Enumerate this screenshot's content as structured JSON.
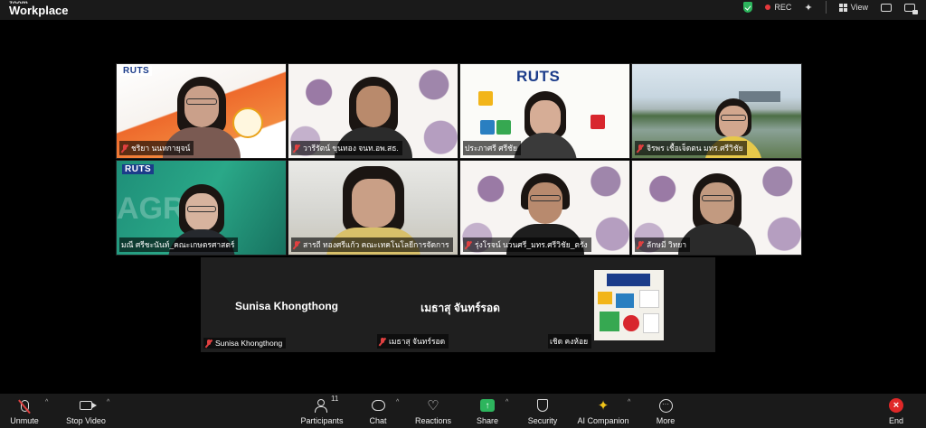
{
  "app": {
    "brand_small": "zoom",
    "brand": "Workplace"
  },
  "topbar": {
    "rec_label": "REC",
    "view_label": "View"
  },
  "gallery": [
    {
      "name": "ชริยา นนทกายุจน์",
      "bg": "orange",
      "logo": "RUTS"
    },
    {
      "name": "วารีรัตน์ ขุนทอง จนท.อพ.สธ.",
      "bg": "leaf"
    },
    {
      "name": "ประภาศรี ศรีชัย",
      "bg": "puzzle",
      "logo": "RUTS"
    },
    {
      "name": "จิรพร เชื้อเจ็ดตน มทร.ศรีวิชัย",
      "bg": "lake"
    },
    {
      "name": "มณี ศรีชะนันท์_คณะเกษตรศาสตร์",
      "bg": "green",
      "logo": "RUTS"
    },
    {
      "name": "สารถี ทองศรีแก้ว คณะเทคโนโลยีการจัดการ",
      "bg": "room"
    },
    {
      "name": "รุ่งโรจน์ นวนศรี_มทร.ศรีวิชัย_ตรัง",
      "bg": "leaf"
    },
    {
      "name": "ลักษมี วิทยา",
      "bg": "leaf"
    }
  ],
  "strip": [
    {
      "display": "Sunisa Khongthong",
      "tag": "Sunisa Khongthong"
    },
    {
      "display": "เมธาสุ จันทร์รอด",
      "tag": "เมธาสุ จันทร์รอด"
    },
    {
      "display": "",
      "tag": "เชิด คงห้อย"
    }
  ],
  "toolbar": {
    "unmute": "Unmute",
    "stop_video": "Stop Video",
    "participants": "Participants",
    "participants_count": "11",
    "chat": "Chat",
    "reactions": "Reactions",
    "share": "Share",
    "security": "Security",
    "ai_companion": "AI Companion",
    "more": "More",
    "end": "End"
  },
  "colors": {
    "accent_green": "#2db55d",
    "end_red": "#e02828",
    "muted_red": "#e04040"
  }
}
